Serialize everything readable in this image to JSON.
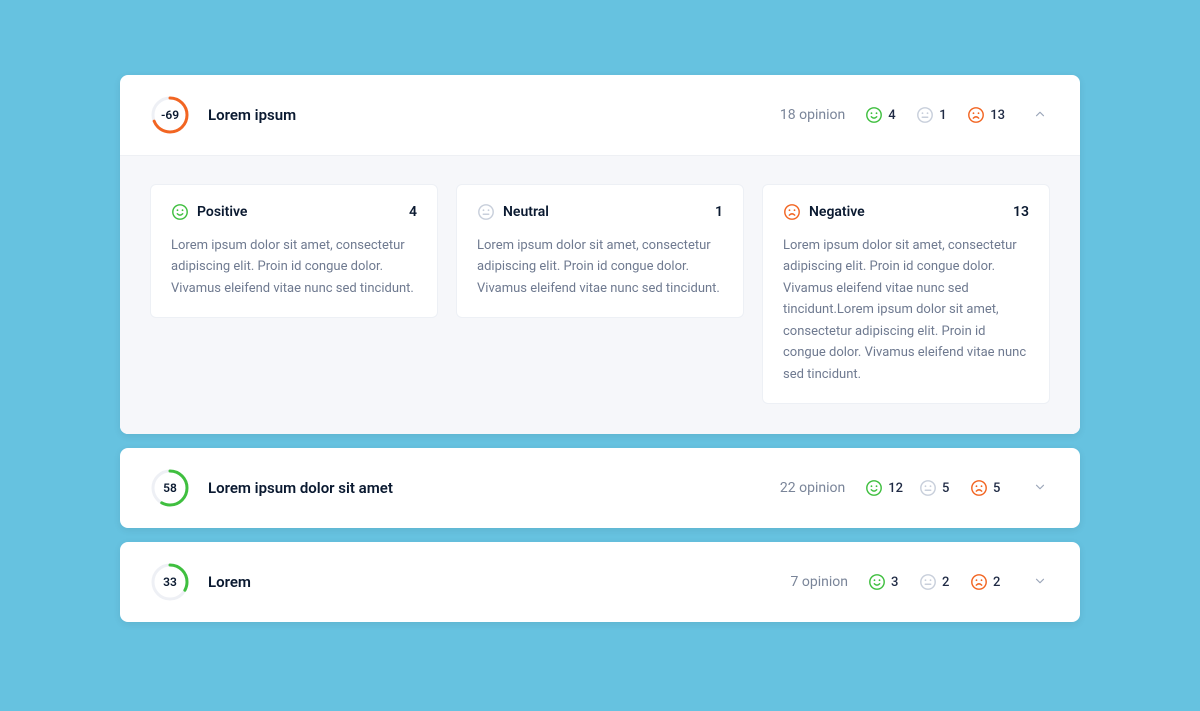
{
  "colors": {
    "positive": "#3fbf3f",
    "neutral": "#c8cfdb",
    "negative": "#f26522"
  },
  "labels": {
    "opinion_suffix": "opinion",
    "positive": "Positive",
    "neutral": "Neutral",
    "negative": "Negative"
  },
  "items": [
    {
      "score": "-69",
      "score_value": -69,
      "ringColor": "#f26522",
      "title": "Lorem ipsum",
      "opinion_text": "18 opinion",
      "pos": "4",
      "neu": "1",
      "neg": "13",
      "expanded": true,
      "details": {
        "pos_count": "4",
        "neu_count": "1",
        "neg_count": "13",
        "pos_body": "Lorem ipsum dolor sit amet, consectetur adipiscing elit. Proin id congue dolor. Vivamus eleifend vitae nunc sed tincidunt.",
        "neu_body": "Lorem ipsum dolor sit amet, consectetur adipiscing elit. Proin id congue dolor. Vivamus eleifend vitae nunc sed tincidunt.",
        "neg_body": "Lorem ipsum dolor sit amet, consectetur adipiscing elit. Proin id congue dolor. Vivamus eleifend vitae nunc sed tincidunt.Lorem ipsum dolor sit amet, consectetur adipiscing elit. Proin id congue dolor. Vivamus eleifend vitae nunc sed tincidunt."
      }
    },
    {
      "score": "58",
      "score_value": 58,
      "ringColor": "#3fbf3f",
      "title": "Lorem ipsum dolor sit amet",
      "opinion_text": "22 opinion",
      "pos": "12",
      "neu": "5",
      "neg": "5",
      "expanded": false
    },
    {
      "score": "33",
      "score_value": 33,
      "ringColor": "#3fbf3f",
      "title": "Lorem",
      "opinion_text": "7 opinion",
      "pos": "3",
      "neu": "2",
      "neg": "2",
      "expanded": false
    }
  ]
}
